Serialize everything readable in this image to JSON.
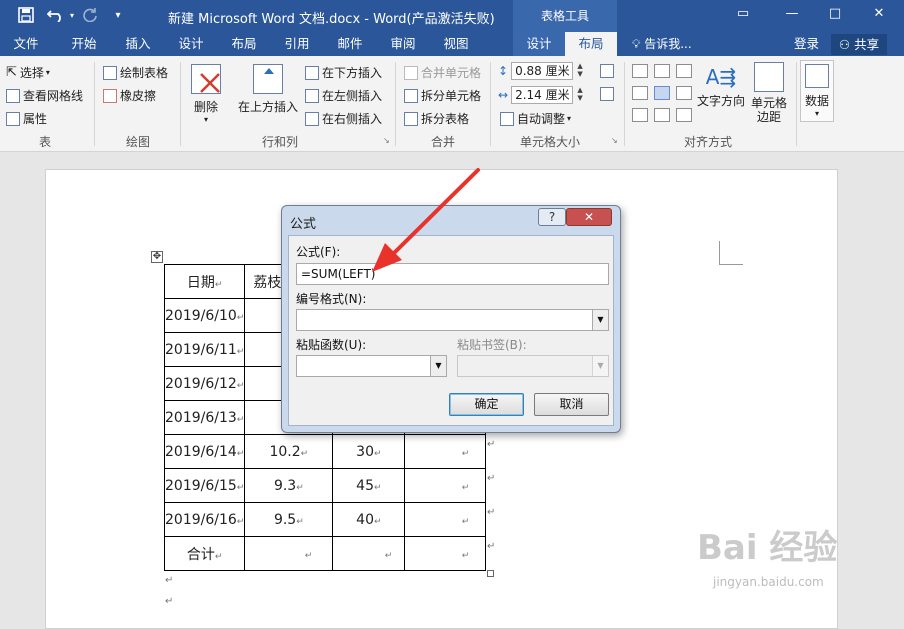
{
  "title_bar": {
    "doc_title": "新建 Microsoft Word 文档.docx - Word(产品激活失败)",
    "context_title": "表格工具",
    "qat": {
      "save_icon": "save-icon",
      "undo_icon": "undo-icon",
      "redo_icon": "redo-icon"
    },
    "win_buttons": {
      "ribbon_display": "▭",
      "minimize": "—",
      "maximize": "□",
      "close": "✕"
    }
  },
  "tabs": [
    {
      "label": "文件"
    },
    {
      "label": "开始"
    },
    {
      "label": "插入"
    },
    {
      "label": "设计"
    },
    {
      "label": "布局"
    },
    {
      "label": "引用"
    },
    {
      "label": "邮件"
    },
    {
      "label": "审阅"
    },
    {
      "label": "视图"
    },
    {
      "label": "设计"
    },
    {
      "label": "布局"
    }
  ],
  "tell_me": "告诉我...",
  "login": "登录",
  "share": "共享",
  "ribbon": {
    "table_group": {
      "select": "选择",
      "view_gridlines": "查看网格线",
      "properties": "属性",
      "label": "表"
    },
    "draw_group": {
      "draw_table": "绘制表格",
      "eraser": "橡皮擦",
      "label": "绘图"
    },
    "rows_cols": {
      "delete": "删除",
      "insert_above": "在上方插入",
      "insert_below": "在下方插入",
      "insert_left": "在左侧插入",
      "insert_right": "在右侧插入",
      "label": "行和列"
    },
    "merge": {
      "merge_cells": "合并单元格",
      "split_cells": "拆分单元格",
      "split_table": "拆分表格",
      "label": "合并"
    },
    "cell_size": {
      "height": "0.88 厘米",
      "width": "2.14 厘米",
      "autofit": "自动调整",
      "label": "单元格大小"
    },
    "alignment": {
      "text_direction": "文字方向",
      "cell_margins": "单元格\n边距",
      "label": "对齐方式"
    },
    "data": {
      "label": "数据"
    }
  },
  "table": {
    "header": [
      "日期",
      "荔枝"
    ],
    "rows": [
      {
        "date": "2019/6/10",
        "v1": "",
        "v2": "",
        "v3": ""
      },
      {
        "date": "2019/6/11",
        "v1": "",
        "v2": "",
        "v3": ""
      },
      {
        "date": "2019/6/12",
        "v1": "",
        "v2": "",
        "v3": ""
      },
      {
        "date": "2019/6/13",
        "v1": "",
        "v2": "",
        "v3": ""
      },
      {
        "date": "2019/6/14",
        "v1": "10.2",
        "v2": "30",
        "v3": ""
      },
      {
        "date": "2019/6/15",
        "v1": "9.3",
        "v2": "45",
        "v3": ""
      },
      {
        "date": "2019/6/16",
        "v1": "9.5",
        "v2": "40",
        "v3": ""
      }
    ],
    "total_label": "合计"
  },
  "dialog": {
    "title": "公式",
    "help": "?",
    "close": "✕",
    "formula_label": "公式(F):",
    "formula_value": "=SUM(LEFT)",
    "number_format_label": "编号格式(N):",
    "number_format_value": "",
    "paste_function_label": "粘贴函数(U):",
    "paste_bookmark_label": "粘贴书签(B):",
    "ok": "确定",
    "cancel": "取消"
  },
  "watermark": {
    "logo": "Bai 经验",
    "url": "jingyan.baidu.com"
  },
  "colors": {
    "word_blue": "#2b579a",
    "context_blue": "#3a68ad",
    "arrow_red": "#e8322b"
  }
}
